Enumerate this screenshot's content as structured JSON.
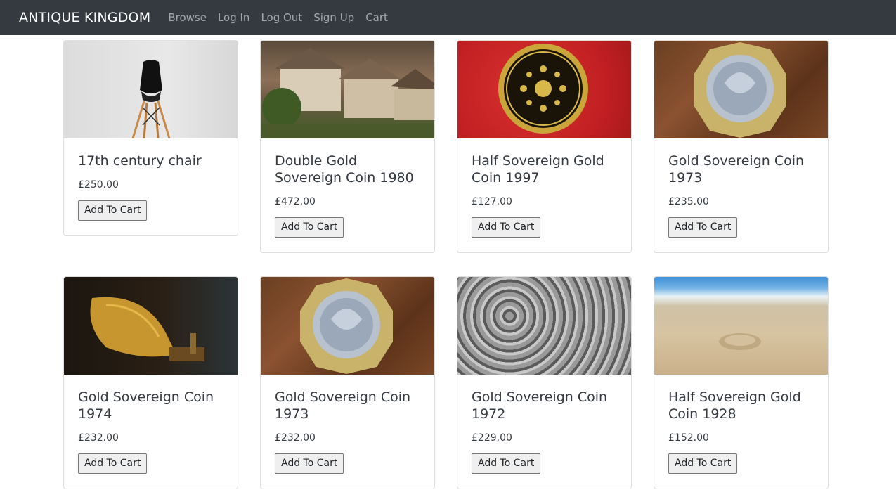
{
  "navbar": {
    "brand": "ANTIQUE KINGDOM",
    "links": [
      "Browse",
      "Log In",
      "Log Out",
      "Sign Up",
      "Cart"
    ]
  },
  "colors": {
    "navbar_bg": "#343a40",
    "brand_text": "#ffffff",
    "nav_link": "rgba(255,255,255,0.55)",
    "card_border": "rgba(0,0,0,0.13)"
  },
  "products": [
    {
      "title": "17th century chair",
      "price": "£250.00",
      "button": "Add To Cart",
      "image": "chair-photo"
    },
    {
      "title": "Double Gold Sovereign Coin 1980",
      "price": "£472.00",
      "button": "Add To Cart",
      "image": "village-cottages-photo"
    },
    {
      "title": "Half Sovereign Gold Coin 1997",
      "price": "£127.00",
      "button": "Add To Cart",
      "image": "gold-coin-on-red-photo"
    },
    {
      "title": "Gold Sovereign Coin 1973",
      "price": "£235.00",
      "button": "Add To Cart",
      "image": "pound-coin-on-wood-photo"
    },
    {
      "title": "Gold Sovereign Coin 1974",
      "price": "£232.00",
      "button": "Add To Cart",
      "image": "gramophone-horn-photo"
    },
    {
      "title": "Gold Sovereign Coin 1973",
      "price": "£232.00",
      "button": "Add To Cart",
      "image": "pound-coin-on-wood-photo"
    },
    {
      "title": "Gold Sovereign Coin 1972",
      "price": "£229.00",
      "button": "Add To Cart",
      "image": "silver-coins-pile-photo"
    },
    {
      "title": "Half Sovereign Gold Coin 1928",
      "price": "£152.00",
      "button": "Add To Cart",
      "image": "coin-on-beach-photo"
    }
  ]
}
